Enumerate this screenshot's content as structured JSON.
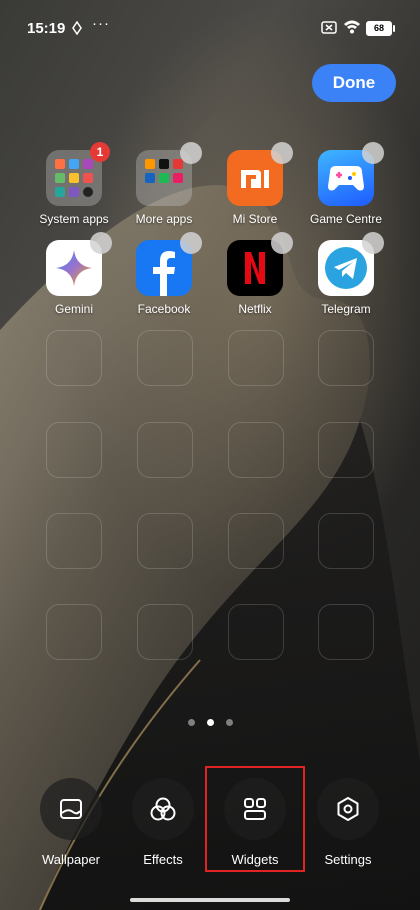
{
  "status_bar": {
    "time": "15:19",
    "battery": "68"
  },
  "done_label": "Done",
  "apps": [
    {
      "label": "System apps",
      "badge": "1"
    },
    {
      "label": "More apps"
    },
    {
      "label": "Mi Store"
    },
    {
      "label": "Game Centre"
    },
    {
      "label": "Gemini"
    },
    {
      "label": "Facebook"
    },
    {
      "label": "Netflix"
    },
    {
      "label": "Telegram"
    }
  ],
  "pager": {
    "pages": 3,
    "current": 2
  },
  "toolbar": [
    {
      "label": "Wallpaper",
      "icon": "wallpaper-icon"
    },
    {
      "label": "Effects",
      "icon": "effects-icon"
    },
    {
      "label": "Widgets",
      "icon": "widgets-icon"
    },
    {
      "label": "Settings",
      "icon": "settings-icon"
    }
  ],
  "colors": {
    "accent": "#3b82f6",
    "highlight": "#e02424",
    "badge": "#e53935"
  }
}
